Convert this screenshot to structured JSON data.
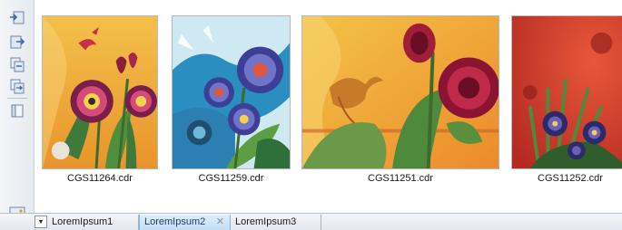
{
  "toolbar": {
    "buttons": [
      {
        "name": "import-icon"
      },
      {
        "name": "export-icon"
      },
      {
        "name": "copy-icon"
      },
      {
        "name": "move-icon"
      },
      {
        "name": "properties-icon"
      }
    ]
  },
  "thumbnails": [
    {
      "filename": "CGS11264.cdr"
    },
    {
      "filename": "CGS11259.cdr"
    },
    {
      "filename": "CGS11251.cdr"
    },
    {
      "filename": "CGS11252.cdr"
    }
  ],
  "tabs": [
    {
      "label": "LoremIpsum1"
    },
    {
      "label": "LoremIpsum2",
      "active": true,
      "close": "✕"
    },
    {
      "label": "LoremIpsum3"
    }
  ],
  "tab_dropdown_glyph": "▼",
  "colors": {
    "active_tab": "#c9e0f5",
    "toolbar_bg": "#eceff4"
  }
}
